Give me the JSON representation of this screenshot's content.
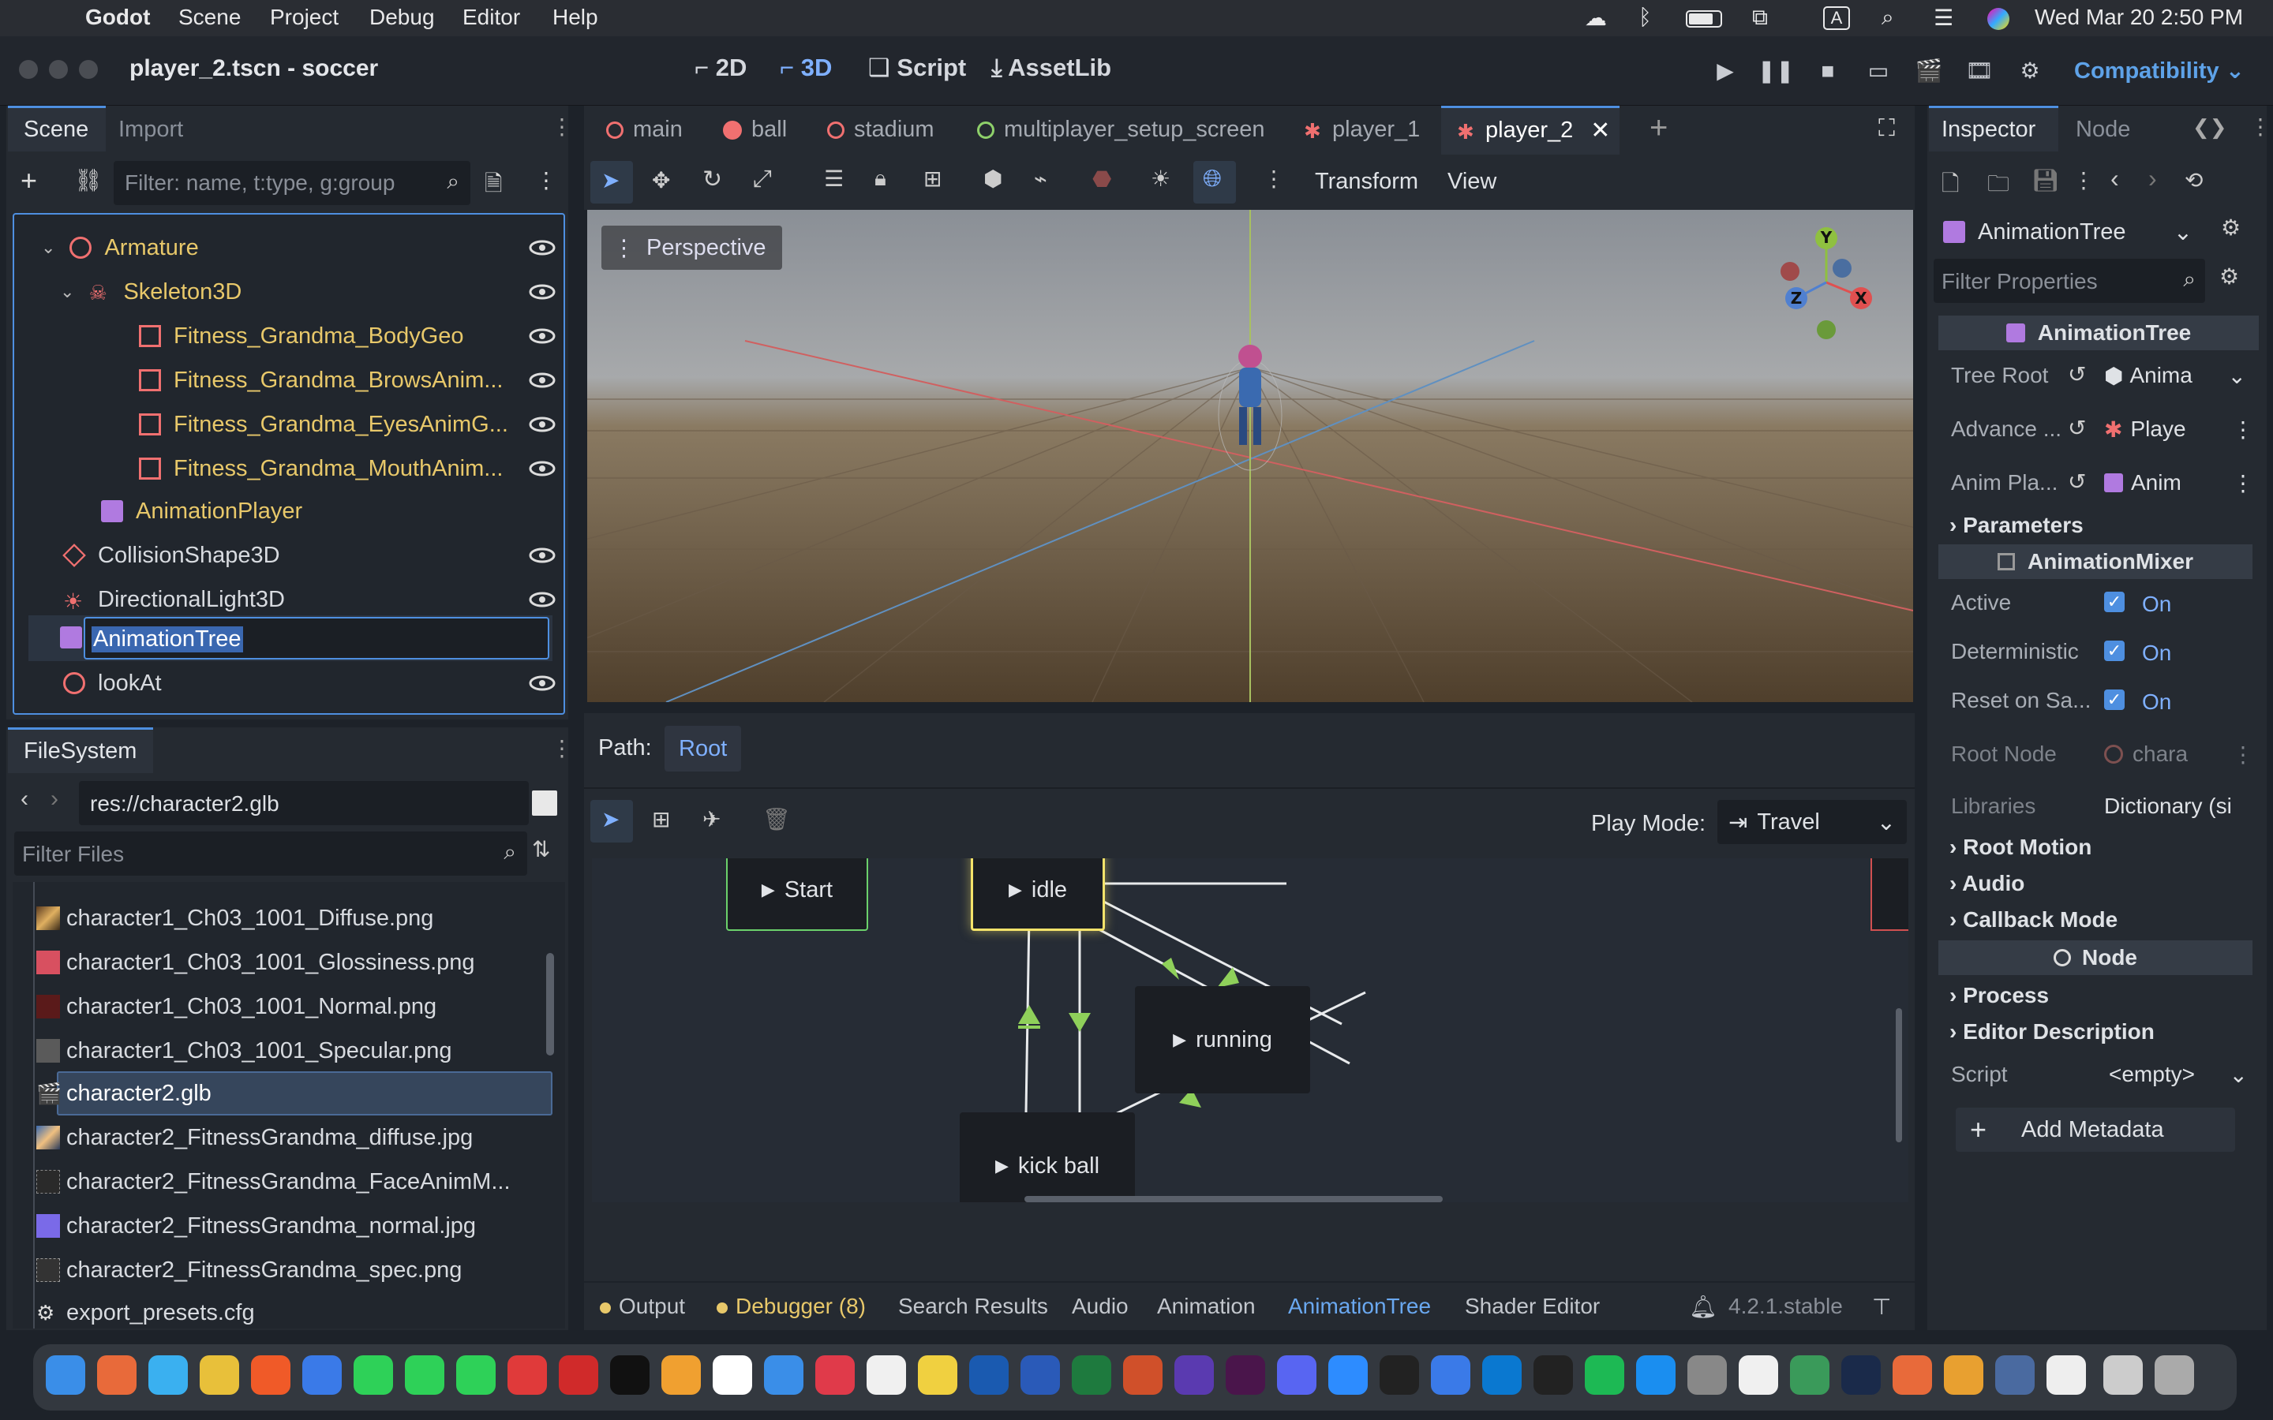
{
  "menubar": {
    "app": "Godot",
    "items": [
      "Scene",
      "Project",
      "Debug",
      "Editor",
      "Help"
    ],
    "clock": "Wed Mar 20  2:50 PM",
    "input_source": "A"
  },
  "titlebar": {
    "title": "player_2.tscn - soccer",
    "modes": [
      "2D",
      "3D",
      "Script",
      "AssetLib"
    ],
    "renderer": "Compatibility"
  },
  "scene_dock": {
    "tabs": [
      "Scene",
      "Import"
    ],
    "filter_placeholder": "Filter: name, t:type, g:group",
    "nodes": [
      {
        "label": "Armature",
        "color": "#e8c86a"
      },
      {
        "label": "Skeleton3D",
        "color": "#e8c86a"
      },
      {
        "label": "Fitness_Grandma_BodyGeo",
        "color": "#e8c86a"
      },
      {
        "label": "Fitness_Grandma_BrowsAnim...",
        "color": "#e8c86a"
      },
      {
        "label": "Fitness_Grandma_EyesAnimG...",
        "color": "#e8c86a"
      },
      {
        "label": "Fitness_Grandma_MouthAnim...",
        "color": "#e8c86a"
      },
      {
        "label": "AnimationPlayer",
        "color": "#e8c86a"
      },
      {
        "label": "CollisionShape3D",
        "color": "#d8dbe0"
      },
      {
        "label": "DirectionalLight3D",
        "color": "#d8dbe0"
      },
      {
        "label": "AnimationTree",
        "color": "#ffffff"
      },
      {
        "label": "lookAt",
        "color": "#d8dbe0"
      }
    ],
    "rename_value": "AnimationTree"
  },
  "filesystem": {
    "tab": "FileSystem",
    "path": "res://character2.glb",
    "filter_placeholder": "Filter Files",
    "files": [
      "character1_Ch03_1001_Diffuse.png",
      "character1_Ch03_1001_Glossiness.png",
      "character1_Ch03_1001_Normal.png",
      "character1_Ch03_1001_Specular.png",
      "character2.glb",
      "character2_FitnessGrandma_diffuse.jpg",
      "character2_FitnessGrandma_FaceAnimM...",
      "character2_FitnessGrandma_normal.jpg",
      "character2_FitnessGrandma_spec.png",
      "export_presets.cfg"
    ]
  },
  "editor_tabs": [
    "main",
    "ball",
    "stadium",
    "multiplayer_setup_screen",
    "player_1",
    "player_2"
  ],
  "viewport": {
    "menu_transform": "Transform",
    "menu_view": "View",
    "perspective": "Perspective",
    "gizmo": {
      "y": "Y",
      "x": "X",
      "z": "Z"
    }
  },
  "anim_tree": {
    "path_label": "Path:",
    "path_root": "Root",
    "play_mode_label": "Play Mode:",
    "play_mode_value": "Travel",
    "states": {
      "start": "Start",
      "idle": "idle",
      "running": "running",
      "kick": "kick ball"
    }
  },
  "bottom_panel": {
    "tabs": [
      "Output",
      "Debugger (8)",
      "Search Results",
      "Audio",
      "Animation",
      "AnimationTree",
      "Shader Editor"
    ],
    "version": "4.2.1.stable"
  },
  "inspector": {
    "tabs": [
      "Inspector",
      "Node"
    ],
    "object": "AnimationTree",
    "filter_placeholder": "Filter Properties",
    "class_header": "AnimationTree",
    "tree_root_label": "Tree Root",
    "tree_root_value": "Anima",
    "advance_label": "Advance ...",
    "advance_value": "Playe",
    "anim_player_label": "Anim Pla...",
    "anim_player_value": "Anim",
    "parameters": "Parameters",
    "mixer_header": "AnimationMixer",
    "active_label": "Active",
    "deterministic_label": "Deterministic",
    "reset_label": "Reset on Sa...",
    "on": "On",
    "root_node_label": "Root Node",
    "root_node_value": "chara",
    "libraries_label": "Libraries",
    "libraries_value": "Dictionary (si",
    "root_motion": "Root Motion",
    "audio": "Audio",
    "callback_mode": "Callback Mode",
    "node_header": "Node",
    "process": "Process",
    "editor_description": "Editor Description",
    "script_label": "Script",
    "script_value": "<empty>",
    "add_metadata": "Add Metadata"
  },
  "colors": {
    "accent": "#4e8fe0",
    "node_yellow": "#e8c86a",
    "state_idle_border": "#f5e36a",
    "start_border": "#6bd16b",
    "transition": "#8fd05a"
  }
}
